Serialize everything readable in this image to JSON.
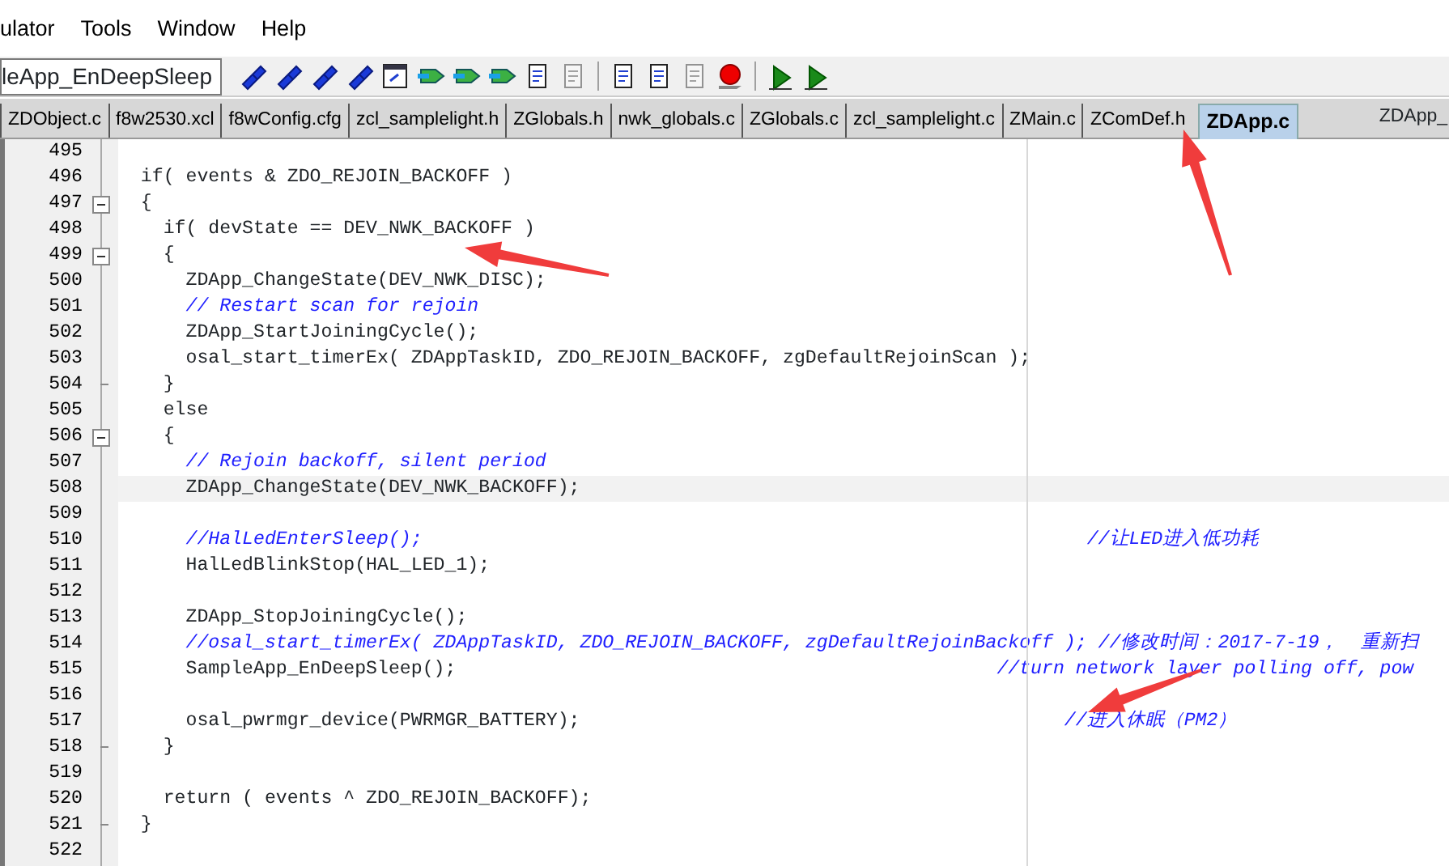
{
  "menu": [
    {
      "label": "ulator"
    },
    {
      "label": "Tools"
    },
    {
      "label": "Window"
    },
    {
      "label": "Help"
    }
  ],
  "toolbar": {
    "combo": {
      "value": "leApp_EnDeepSleep"
    },
    "buttons": [
      {
        "kind": "find",
        "disabled": false
      },
      {
        "kind": "find",
        "disabled": false
      },
      {
        "kind": "find",
        "disabled": false
      },
      {
        "kind": "find",
        "disabled": false
      },
      {
        "kind": "window",
        "disabled": false
      },
      {
        "kind": "tag",
        "disabled": false
      },
      {
        "kind": "tag",
        "disabled": false
      },
      {
        "kind": "tag",
        "disabled": false
      },
      {
        "kind": "doc",
        "disabled": false
      },
      {
        "kind": "doc",
        "disabled": true
      },
      {
        "kind": "separator"
      },
      {
        "kind": "doc",
        "disabled": false
      },
      {
        "kind": "doc",
        "disabled": false
      },
      {
        "kind": "doc",
        "disabled": true
      },
      {
        "kind": "breakpoint",
        "disabled": false
      },
      {
        "kind": "separator"
      },
      {
        "kind": "play",
        "disabled": false
      },
      {
        "kind": "play",
        "disabled": false
      }
    ]
  },
  "tabs": [
    {
      "label": "ZDObject.c",
      "selected": false
    },
    {
      "label": "f8w2530.xcl",
      "selected": false
    },
    {
      "label": "f8wConfig.cfg",
      "selected": false
    },
    {
      "label": "zcl_samplelight.h",
      "selected": false
    },
    {
      "label": "ZGlobals.h",
      "selected": false
    },
    {
      "label": "nwk_globals.c",
      "selected": false
    },
    {
      "label": "ZGlobals.c",
      "selected": false
    },
    {
      "label": "zcl_samplelight.c",
      "selected": false
    },
    {
      "label": "ZMain.c",
      "selected": false
    },
    {
      "label": "ZComDef.h",
      "selected": false
    },
    {
      "label": "ZDApp.c",
      "selected": true
    }
  ],
  "function_box": {
    "value": "ZDApp_"
  },
  "editor": {
    "lines": [
      {
        "number": "495"
      },
      {
        "number": "496",
        "segments": [
          {
            "kind": "code",
            "text": "  if( events & ZDO_REJOIN_BACKOFF )"
          }
        ]
      },
      {
        "number": "497",
        "fold_toggle": true,
        "segments": [
          {
            "kind": "code",
            "text": "  {"
          }
        ]
      },
      {
        "number": "498",
        "segments": [
          {
            "kind": "code",
            "text": "    if( devState == DEV_NWK_BACKOFF )"
          }
        ]
      },
      {
        "number": "499",
        "fold_toggle": true,
        "segments": [
          {
            "kind": "code",
            "text": "    {"
          }
        ]
      },
      {
        "number": "500",
        "segments": [
          {
            "kind": "code",
            "text": "      ZDApp_ChangeState(DEV_NWK_DISC);"
          }
        ]
      },
      {
        "number": "501",
        "segments": [
          {
            "kind": "comment",
            "text": "      // Restart scan for rejoin"
          }
        ]
      },
      {
        "number": "502",
        "segments": [
          {
            "kind": "code",
            "text": "      ZDApp_StartJoiningCycle();"
          }
        ]
      },
      {
        "number": "503",
        "segments": [
          {
            "kind": "code",
            "text": "      osal_start_timerEx( ZDAppTaskID, ZDO_REJOIN_BACKOFF, zgDefaultRejoinScan );"
          }
        ]
      },
      {
        "number": "504",
        "fold_end": true,
        "segments": [
          {
            "kind": "code",
            "text": "    }"
          }
        ]
      },
      {
        "number": "505",
        "segments": [
          {
            "kind": "code",
            "text": "    else"
          }
        ]
      },
      {
        "number": "506",
        "fold_toggle": true,
        "segments": [
          {
            "kind": "code",
            "text": "    {"
          }
        ]
      },
      {
        "number": "507",
        "segments": [
          {
            "kind": "comment",
            "text": "      // Rejoin backoff, silent period"
          }
        ]
      },
      {
        "number": "508",
        "current": true,
        "segments": [
          {
            "kind": "code",
            "text": "      ZDApp_ChangeState(DEV_NWK_BACKOFF);"
          }
        ]
      },
      {
        "number": "509"
      },
      {
        "number": "510",
        "segments": [
          {
            "kind": "comment",
            "text": "      //HalLedEnterSleep();"
          },
          {
            "kind": "comment",
            "text": "                                                           //让LED进入低功耗"
          }
        ]
      },
      {
        "number": "511",
        "segments": [
          {
            "kind": "code",
            "text": "      HalLedBlinkStop(HAL_LED_1);"
          }
        ]
      },
      {
        "number": "512"
      },
      {
        "number": "513",
        "segments": [
          {
            "kind": "code",
            "text": "      ZDApp_StopJoiningCycle();"
          }
        ]
      },
      {
        "number": "514",
        "segments": [
          {
            "kind": "comment",
            "text": "      //osal_start_timerEx( ZDAppTaskID, ZDO_REJOIN_BACKOFF, zgDefaultRejoinBackoff ); //修改时间：2017-7-19，  重新扫"
          }
        ]
      },
      {
        "number": "515",
        "segments": [
          {
            "kind": "code",
            "text": "      SampleApp_EnDeepSleep();"
          },
          {
            "kind": "comment",
            "text": "                                                //turn network layer polling off, pow"
          }
        ]
      },
      {
        "number": "516"
      },
      {
        "number": "517",
        "segments": [
          {
            "kind": "code",
            "text": "      osal_pwrmgr_device(PWRMGR_BATTERY);"
          },
          {
            "kind": "comment",
            "text": "                                           //进入休眠（PM2）"
          }
        ]
      },
      {
        "number": "518",
        "fold_end": true,
        "segments": [
          {
            "kind": "code",
            "text": "    }"
          }
        ]
      },
      {
        "number": "519"
      },
      {
        "number": "520",
        "segments": [
          {
            "kind": "code",
            "text": "    return ( events ^ ZDO_REJOIN_BACKOFF);"
          }
        ]
      },
      {
        "number": "521",
        "fold_end": true,
        "segments": [
          {
            "kind": "code",
            "text": "  }"
          }
        ]
      },
      {
        "number": "522"
      }
    ]
  }
}
